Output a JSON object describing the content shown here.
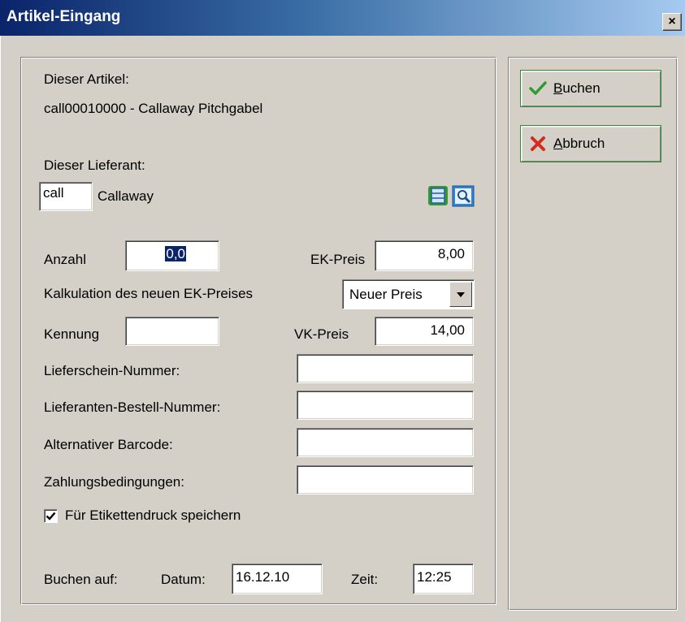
{
  "window": {
    "title": "Artikel-Eingang",
    "close_label": "×"
  },
  "article": {
    "label": "Dieser Artikel:",
    "value": "call00010000 - Callaway Pitchgabel"
  },
  "supplier": {
    "label": "Dieser Lieferant:",
    "code": "call",
    "name": "Callaway",
    "icons": [
      "list-icon",
      "search-icon"
    ]
  },
  "form": {
    "anzahl_label": "Anzahl",
    "anzahl_value": "0,0",
    "ek_label": "EK-Preis",
    "ek_value": "8,00",
    "kalkulation_label": "Kalkulation des neuen EK-Preises",
    "kalkulation_value": "Neuer Preis",
    "kennung_label": "Kennung",
    "kennung_value": "",
    "vk_label": "VK-Preis",
    "vk_value": "14,00",
    "lieferschein_label": "Lieferschein-Nummer:",
    "lieferschein_value": "",
    "bestell_label": "Lieferanten-Bestell-Nummer:",
    "bestell_value": "",
    "barcode_label": "Alternativer Barcode:",
    "barcode_value": "",
    "zahlung_label": "Zahlungsbedingungen:",
    "zahlung_value": "",
    "etikett_label": "Für Etikettendruck speichern",
    "etikett_checked": true
  },
  "booking": {
    "label": "Buchen auf:",
    "datum_label": "Datum:",
    "datum_value": "16.12.10",
    "zeit_label": "Zeit:",
    "zeit_value": "12:25"
  },
  "buttons": {
    "buchen_first": "B",
    "buchen_rest": "uchen",
    "abbruch_first": "A",
    "abbruch_rest": "bbruch"
  },
  "colors": {
    "title_gradient_start": "#0a246a",
    "title_gradient_end": "#a6caf0",
    "face": "#d4d0c8",
    "ok_green": "#2e9b2e",
    "cancel_red": "#d22b1f",
    "selection": "#0a246a"
  }
}
